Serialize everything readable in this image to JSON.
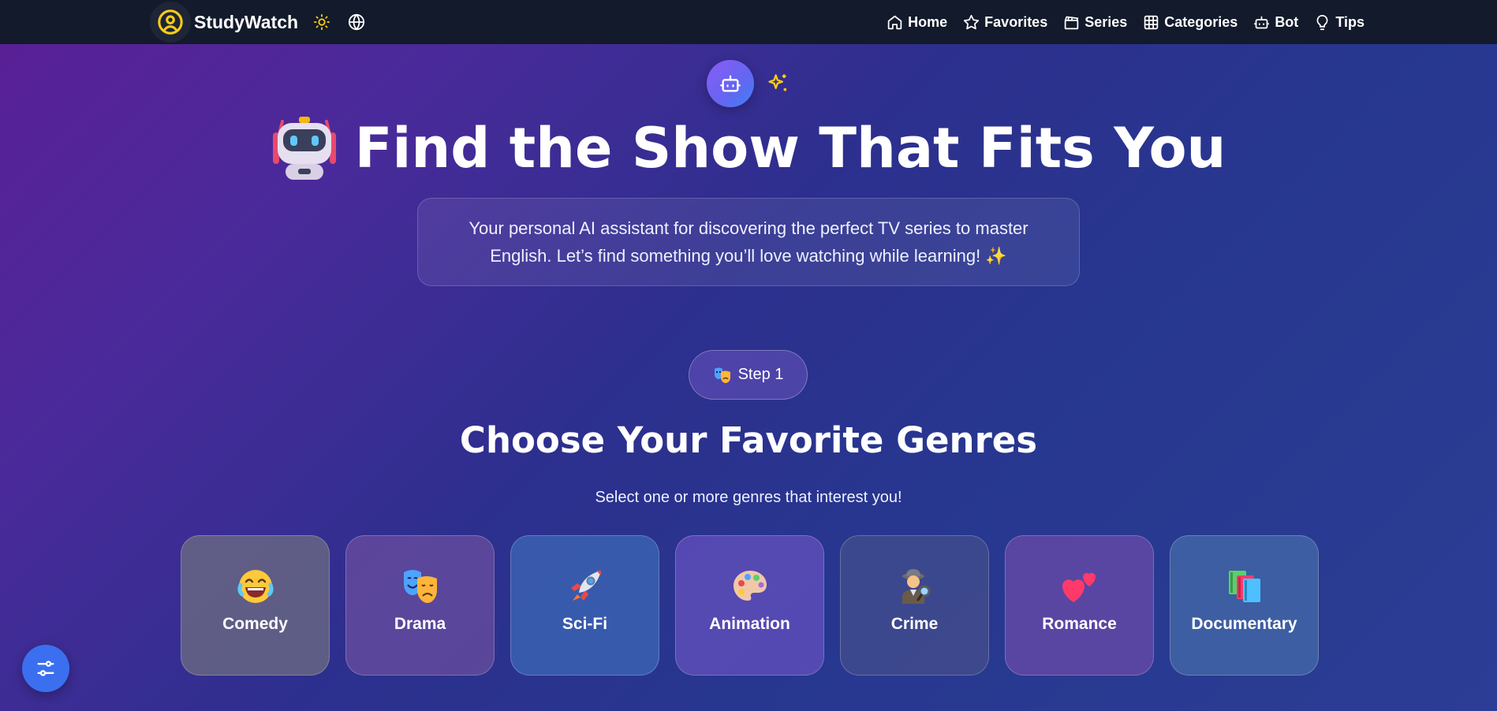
{
  "app": {
    "name": "StudyWatch"
  },
  "nav": {
    "links": [
      {
        "label": "Home",
        "icon": "home-icon"
      },
      {
        "label": "Favorites",
        "icon": "star-icon"
      },
      {
        "label": "Series",
        "icon": "clapperboard-icon"
      },
      {
        "label": "Categories",
        "icon": "grid-icon"
      },
      {
        "label": "Bot",
        "icon": "bot-icon"
      },
      {
        "label": "Tips",
        "icon": "lightbulb-icon"
      }
    ]
  },
  "hero": {
    "title": "Find the Show That Fits You",
    "description": "Your personal AI assistant for discovering the perfect TV series to master English. Let’s find something you’ll love watching while learning! ✨"
  },
  "step": {
    "label": "Step 1"
  },
  "genres_section": {
    "title": "Choose Your Favorite Genres",
    "subtitle": "Select one or more genres that interest you!",
    "genres": [
      {
        "label": "Comedy",
        "icon": "laughing-face-icon",
        "color": "#5a5878"
      },
      {
        "label": "Drama",
        "icon": "theater-masks-icon",
        "color": "#5a4a8e"
      },
      {
        "label": "Sci-Fi",
        "icon": "rocket-icon",
        "color": "#3a58a8"
      },
      {
        "label": "Animation",
        "icon": "palette-icon",
        "color": "#5a4eab"
      },
      {
        "label": "Crime",
        "icon": "detective-icon",
        "color": "#3a4080"
      },
      {
        "label": "Romance",
        "icon": "two-hearts-icon",
        "color": "#5a4392"
      },
      {
        "label": "Documentary",
        "icon": "books-icon",
        "color": "#3d5d98"
      }
    ]
  },
  "colors": {
    "navbar": "#121a2b",
    "brand_accent": "#facc15",
    "fab": "#3b6ff0"
  }
}
